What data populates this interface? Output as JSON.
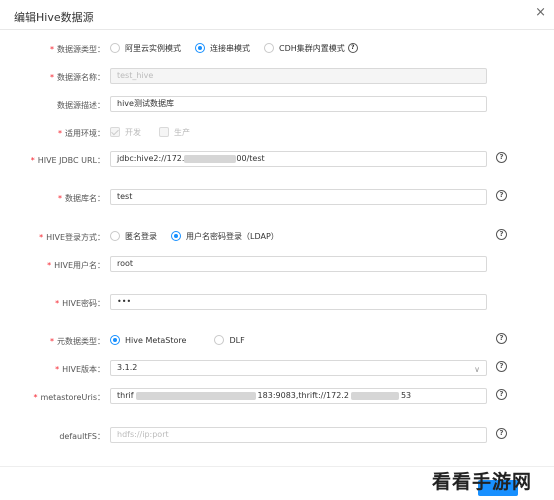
{
  "dialog": {
    "title": "编辑Hive数据源",
    "close_glyph": "×"
  },
  "form": {
    "datasource_type": {
      "label": "数据源类型：",
      "options": [
        "阿里云实例模式",
        "连接串模式",
        "CDH集群内置模式"
      ],
      "selected": "连接串模式"
    },
    "datasource_name": {
      "label": "数据源名称：",
      "value": "test_hive"
    },
    "datasource_desc": {
      "label": "数据源描述：",
      "value": "hive测试数据库"
    },
    "environment": {
      "label": "适用环境：",
      "options": [
        "开发",
        "生产"
      ],
      "checked": [
        "开发"
      ]
    },
    "jdbc_url": {
      "label": "HIVE JDBC URL：",
      "value_prefix": "jdbc:hive2://172.",
      "value_suffix": "00/test"
    },
    "database_name": {
      "label": "数据库名：",
      "value": "test"
    },
    "login_method": {
      "label": "HIVE登录方式：",
      "options": [
        "匿名登录",
        "用户名密码登录（LDAP）"
      ],
      "selected": "用户名密码登录（LDAP）"
    },
    "username": {
      "label": "HIVE用户名：",
      "value": "root"
    },
    "password": {
      "label": "HIVE密码：",
      "value": "•••"
    },
    "metadata_type": {
      "label": "元数据类型：",
      "options": [
        "Hive MetaStore",
        "DLF"
      ],
      "selected": "Hive MetaStore"
    },
    "hive_version": {
      "label": "HIVE版本：",
      "value": "3.1.2"
    },
    "metastore_uris": {
      "label": "metastoreUris：",
      "value_prefix": "thrif",
      "value_mid": "183:9083,thrift://172.2",
      "value_suffix": "53"
    },
    "default_fs": {
      "label": "defaultFS：",
      "placeholder": "hdfs://ip:port"
    }
  },
  "watermark": {
    "text": "看看手游网"
  },
  "colors": {
    "accent": "#1890ff",
    "required": "#f5222d"
  }
}
